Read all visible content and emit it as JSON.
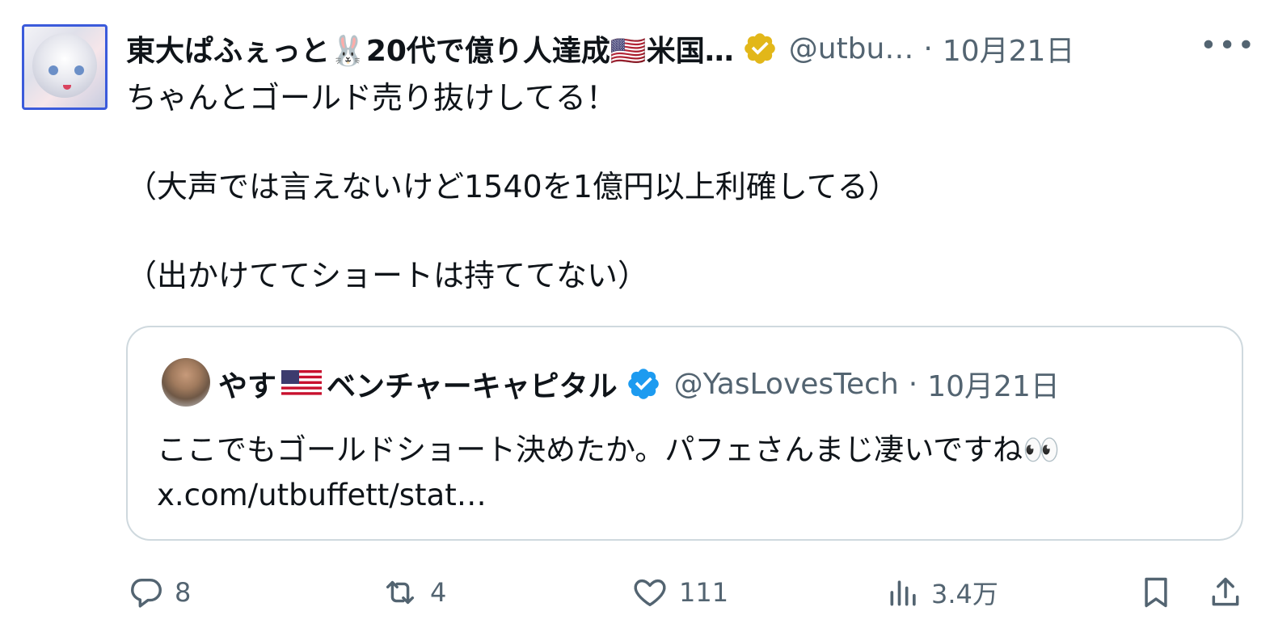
{
  "tweet": {
    "display_name": "東大ぱふぇっと🐰20代で億り人達成🇺🇸米国…",
    "handle": "@utbu…",
    "separator": "·",
    "date": "10月21日",
    "more_label": "•••",
    "body": "ちゃんとゴールド売り抜けしてる！\n\n（大声では言えないけど1540を1億円以上利確してる）\n\n（出かけててショートは持ててない）"
  },
  "quote": {
    "name_part1": "やす",
    "name_part2": "ベンチャーキャピタル",
    "handle": "@YasLovesTech",
    "separator": "·",
    "date": "10月21日",
    "text_line1": "ここでもゴールドショート決めたか。パフェさんまじ凄いですね👀",
    "text_line2": "x.com/utbuffett/stat…"
  },
  "actions": {
    "reply_count": "8",
    "retweet_count": "4",
    "like_count": "111",
    "views_count": "3.4万"
  },
  "colors": {
    "text": "#0f1419",
    "secondary": "#536471",
    "verified_gold": "#e2b719",
    "verified_blue": "#1d9bf0",
    "border": "#cfd9de"
  },
  "icons": [
    "verified-gold-icon",
    "more-icon",
    "verified-blue-icon",
    "us-flag-icon",
    "reply-icon",
    "retweet-icon",
    "like-icon",
    "views-icon",
    "bookmark-icon",
    "share-icon"
  ]
}
